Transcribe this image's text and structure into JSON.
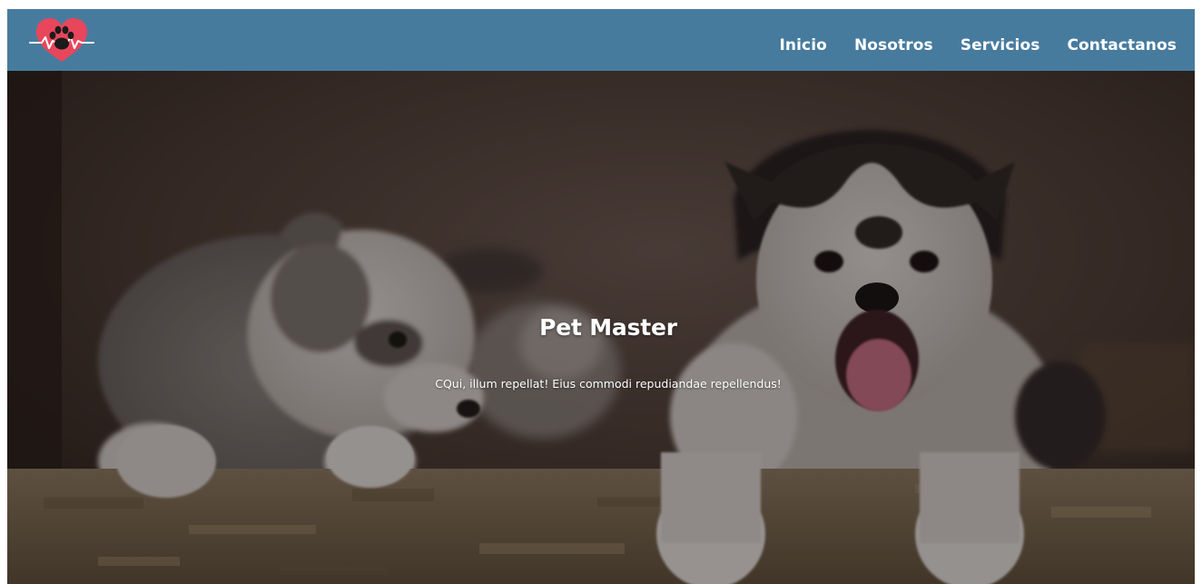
{
  "navbar": {
    "logo_icon": "heart-paw-heartbeat-icon",
    "colors": {
      "background": "#477b9e",
      "logo_heart": "#e8465c",
      "text": "#ffffff"
    },
    "links": [
      {
        "label": "Inicio"
      },
      {
        "label": "Nosotros"
      },
      {
        "label": "Servicios"
      },
      {
        "label": "Contactanos"
      }
    ]
  },
  "hero": {
    "title": "Pet Master",
    "subtitle": "CQui, illum repellat! Eius commodi repudiandae repellendus!"
  }
}
